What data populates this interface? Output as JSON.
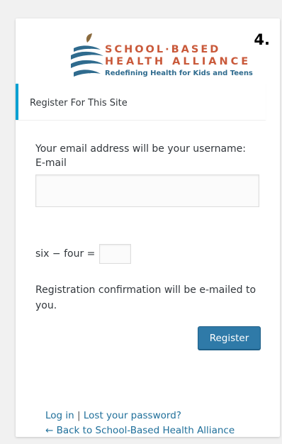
{
  "step": {
    "number": "4."
  },
  "logo": {
    "line1": "SCHOOL·BASED",
    "line2": "HEALTH ALLIANCE",
    "tagline": "Redefining Health for Kids and Teens"
  },
  "message": {
    "text": "Register For This Site"
  },
  "form": {
    "username_note": "Your email address will be your username:",
    "email_label": "E-mail",
    "email_value": "",
    "math_question": "six − four =",
    "math_value": "",
    "confirmation_text": "Registration confirmation will be e-mailed to you.",
    "register_label": "Register"
  },
  "nav": {
    "login_label": "Log in",
    "separator": "|",
    "lost_password_label": "Lost your password?",
    "back_label": "← Back to School-Based Health Alliance"
  },
  "colors": {
    "accent": "#00a0d2",
    "button": "#2f7aa8",
    "link": "#1f6f9a",
    "brand": "#c9593a"
  }
}
